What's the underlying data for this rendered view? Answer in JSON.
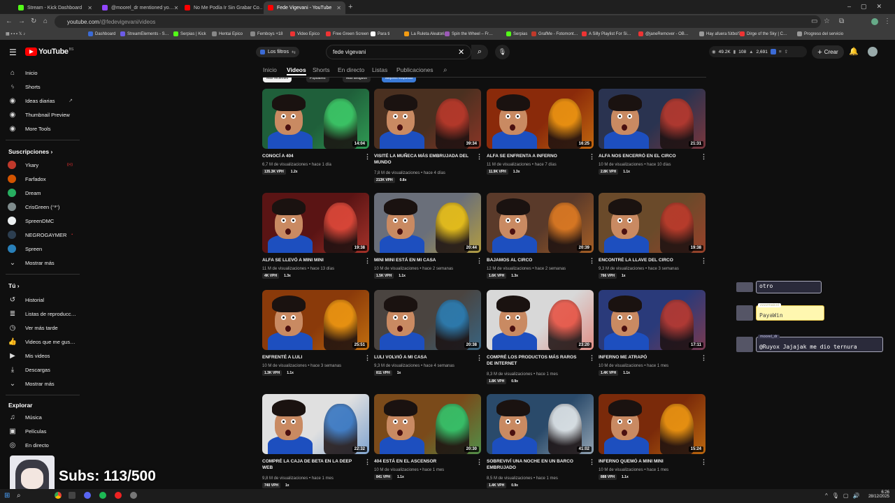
{
  "browser": {
    "tabs": [
      {
        "title": "Stream - Kick Dashboard",
        "color": "#53fc18",
        "active": false
      },
      {
        "title": "@moorel_dr mentioned yo…",
        "color": "#9146ff",
        "active": false
      },
      {
        "title": "No Me Podía Ir Sin Grabar Co…",
        "color": "#ff0000",
        "active": false
      },
      {
        "title": "Fede Vigevani - YouTube",
        "color": "#ff0000",
        "active": true
      }
    ],
    "url_host": "youtube.com",
    "url_path": "/@fedevigevani/videos",
    "bookmarks": [
      "Dashboard",
      "StreamElements - S…",
      "Serpias | Kick",
      "Hentai Epico",
      "Femboys +18",
      "Video Epico",
      "Free Green Screen -…",
      "Para ti",
      "La Ruleta Aleatoria",
      "Spin the Wheel – Fr…",
      "Serpias",
      "GrafMe - Fotomont…",
      "A Silly Playlist For Si…",
      "@janeRemover - OB…",
      "Hay afuera fútbol?",
      "Dirge of the Sky | C…",
      "Progreso del servicio"
    ]
  },
  "header": {
    "logo_text": "YouTube",
    "logo_sup": "BS",
    "filters_label": "Los filtros",
    "search_value": "fede vigevani",
    "stats": [
      "49.2K",
      "108",
      "2,691"
    ],
    "create_label": "Crear"
  },
  "sidebar": {
    "main": [
      {
        "label": "Inicio",
        "icon": "home-icon"
      },
      {
        "label": "Shorts",
        "icon": "shorts-icon"
      },
      {
        "label": "Ideas diarias",
        "icon": "ideas-icon"
      },
      {
        "label": "Thumbnail Preview",
        "icon": "thumbnail-icon"
      },
      {
        "label": "More Tools",
        "icon": "tools-icon"
      }
    ],
    "subs_heading": "Suscripciones",
    "subs": [
      {
        "label": "Ykary",
        "color": "#c0392b"
      },
      {
        "label": "Farfadox",
        "color": "#d35400"
      },
      {
        "label": "Dream",
        "color": "#27ae60"
      },
      {
        "label": "CrisGreen (ᵔ³ᵔ)",
        "color": "#7f8c8d"
      },
      {
        "label": "SpreenDMC",
        "color": "#ecf0f1"
      },
      {
        "label": "NEGROGAYMER",
        "color": "#2c3e50"
      },
      {
        "label": "Spreen",
        "color": "#2980b9"
      },
      {
        "label": "Mostrar más",
        "color": ""
      }
    ],
    "you_heading": "Tú",
    "you": [
      {
        "label": "Historial",
        "icon": "history-icon"
      },
      {
        "label": "Listas de reproducc…",
        "icon": "playlist-icon"
      },
      {
        "label": "Ver más tarde",
        "icon": "clock-icon"
      },
      {
        "label": "Videos que me gus…",
        "icon": "like-icon"
      },
      {
        "label": "Mis videos",
        "icon": "my-videos-icon"
      },
      {
        "label": "Descargas",
        "icon": "download-icon"
      },
      {
        "label": "Mostrar más",
        "icon": "chevron-down-icon"
      }
    ],
    "explore_heading": "Explorar",
    "explore": [
      {
        "label": "Música",
        "icon": "music-icon"
      },
      {
        "label": "Películas",
        "icon": "film-icon"
      },
      {
        "label": "En directo",
        "icon": "live-icon"
      }
    ]
  },
  "channel_tabs": [
    "Inicio",
    "Videos",
    "Shorts",
    "En directo",
    "Listas",
    "Publicaciones"
  ],
  "active_tab": "Videos",
  "chips": [
    "Más recientes",
    "Populares",
    "Más antiguos",
    "Mejores etiquetas"
  ],
  "videos": [
    {
      "title": "CONOCÍ A 404",
      "views": "6,7 M de visualizaciones",
      "ago": "hace 1 día",
      "vph": "135.3K VPH",
      "ratio": "1.2x",
      "duration": "14:04",
      "bg": "#1f5f3a",
      "accent": "#3ecf6a"
    },
    {
      "title": "VISITÉ LA MUÑECA MÁS EMBRUJADA DEL MUNDO",
      "views": "7,8 M de visualizaciones",
      "ago": "hace 4 días",
      "vph": "213K VPH",
      "ratio": "0.8x",
      "duration": "39:34",
      "bg": "#4a3020",
      "accent": "#c0392b"
    },
    {
      "title": "ALFA SE ENFRENTA A INFERNO",
      "views": "11 M de visualizaciones",
      "ago": "hace 7 días",
      "vph": "11.9K VPH",
      "ratio": "1.3x",
      "duration": "16:25",
      "bg": "#8a2a0a",
      "accent": "#f39c12"
    },
    {
      "title": "ALFA NOS ENCERRÓ EN EL CIRCO",
      "views": "10 M de visualizaciones",
      "ago": "hace 10 días",
      "vph": "2.8K VPH",
      "ratio": "1.1x",
      "duration": "21:31",
      "bg": "#2a3350",
      "accent": "#c0392b"
    },
    {
      "title": "ALFA SE LLEVÓ A MINI MINI",
      "views": "11 M de visualizaciones",
      "ago": "hace 13 días",
      "vph": "4K VPH",
      "ratio": "1.3x",
      "duration": "19:38",
      "bg": "#5a1414",
      "accent": "#e74c3c"
    },
    {
      "title": "MINI MINI ESTÁ EN MI CASA",
      "views": "10 M de visualizaciones",
      "ago": "hace 2 semanas",
      "vph": "1.5K VPH",
      "ratio": "1.1x",
      "duration": "20:44",
      "bg": "#6a6f7a",
      "accent": "#f1c40f"
    },
    {
      "title": "BAJAMOS AL CIRCO",
      "views": "12 M de visualizaciones",
      "ago": "hace 2 semanas",
      "vph": "1.6K VPH",
      "ratio": "1.3x",
      "duration": "20:39",
      "bg": "#5a3a2a",
      "accent": "#e67e22"
    },
    {
      "title": "ENCONTRÉ LA LLAVE DEL CIRCO",
      "views": "9,3 M de visualizaciones",
      "ago": "hace 3 semanas",
      "vph": "766 VPH",
      "ratio": "1x",
      "duration": "19:38",
      "bg": "#6a4a2a",
      "accent": "#c0392b"
    },
    {
      "title": "ENFRENTÉ A LULI",
      "views": "10 M de visualizaciones",
      "ago": "hace 3 semanas",
      "vph": "1.3K VPH",
      "ratio": "1.1x",
      "duration": "25:51",
      "bg": "#8a3a0a",
      "accent": "#f39c12"
    },
    {
      "title": "LULI VOLVIÓ A MI CASA",
      "views": "9,3 M de visualizaciones",
      "ago": "hace 4 semanas",
      "vph": "811 VPH",
      "ratio": "1x",
      "duration": "20:38",
      "bg": "#4a4440",
      "accent": "#2980b9"
    },
    {
      "title": "COMPRÉ LOS PRODUCTOS MÁS RAROS DE INTERNET",
      "views": "8,3 M de visualizaciones",
      "ago": "hace 1 mes",
      "vph": "1.8K VPH",
      "ratio": "0.9x",
      "duration": "23:20",
      "bg": "#d8d8d8",
      "accent": "#e74c3c"
    },
    {
      "title": "INFERNO ME ATRAPÓ",
      "views": "10 M de visualizaciones",
      "ago": "hace 1 mes",
      "vph": "1.4K VPH",
      "ratio": "1.1x",
      "duration": "17:11",
      "bg": "#2a3a7a",
      "accent": "#c0392b"
    },
    {
      "title": "COMPRÉ LA CAJA DE BETA EN LA DEEP WEB",
      "views": "9,8 M de visualizaciones",
      "ago": "hace 1 mes",
      "vph": "740 VPH",
      "ratio": "1x",
      "duration": "22:32",
      "bg": "#e0e0e0",
      "accent": "#2c6fbf"
    },
    {
      "title": "404 ESTÁ EN EL ASCENSOR",
      "views": "10 M de visualizaciones",
      "ago": "hace 1 mes",
      "vph": "841 VPH",
      "ratio": "1.1x",
      "duration": "20:30",
      "bg": "#7a4a1a",
      "accent": "#2ecc71"
    },
    {
      "title": "SOBREVIVÍ UNA NOCHE EN UN BARCO EMBRUJADO",
      "views": "8,5 M de visualizaciones",
      "ago": "hace 1 mes",
      "vph": "1.4K VPH",
      "ratio": "0.9x",
      "duration": "41:02",
      "bg": "#2a4a6a",
      "accent": "#ecf0f1"
    },
    {
      "title": "INFERNO QUEMÓ A MINI MINI",
      "views": "10 M de visualizaciones",
      "ago": "hace 1 mes",
      "vph": "888 VPH",
      "ratio": "1.1x",
      "duration": "15:24",
      "bg": "#7a2a0a",
      "accent": "#f39c12"
    }
  ],
  "chat": [
    {
      "user": "",
      "msg": "otro"
    },
    {
      "user": "zzzzmaicol",
      "msg": "PayaWin"
    },
    {
      "user": "moorel_dr",
      "msg": "@Ruyox Jajajak me dio ternura"
    }
  ],
  "overlay": {
    "subs_text": "Subs: 113/500"
  },
  "taskbar": {
    "time": "6:26",
    "date": "28/12/2025"
  }
}
